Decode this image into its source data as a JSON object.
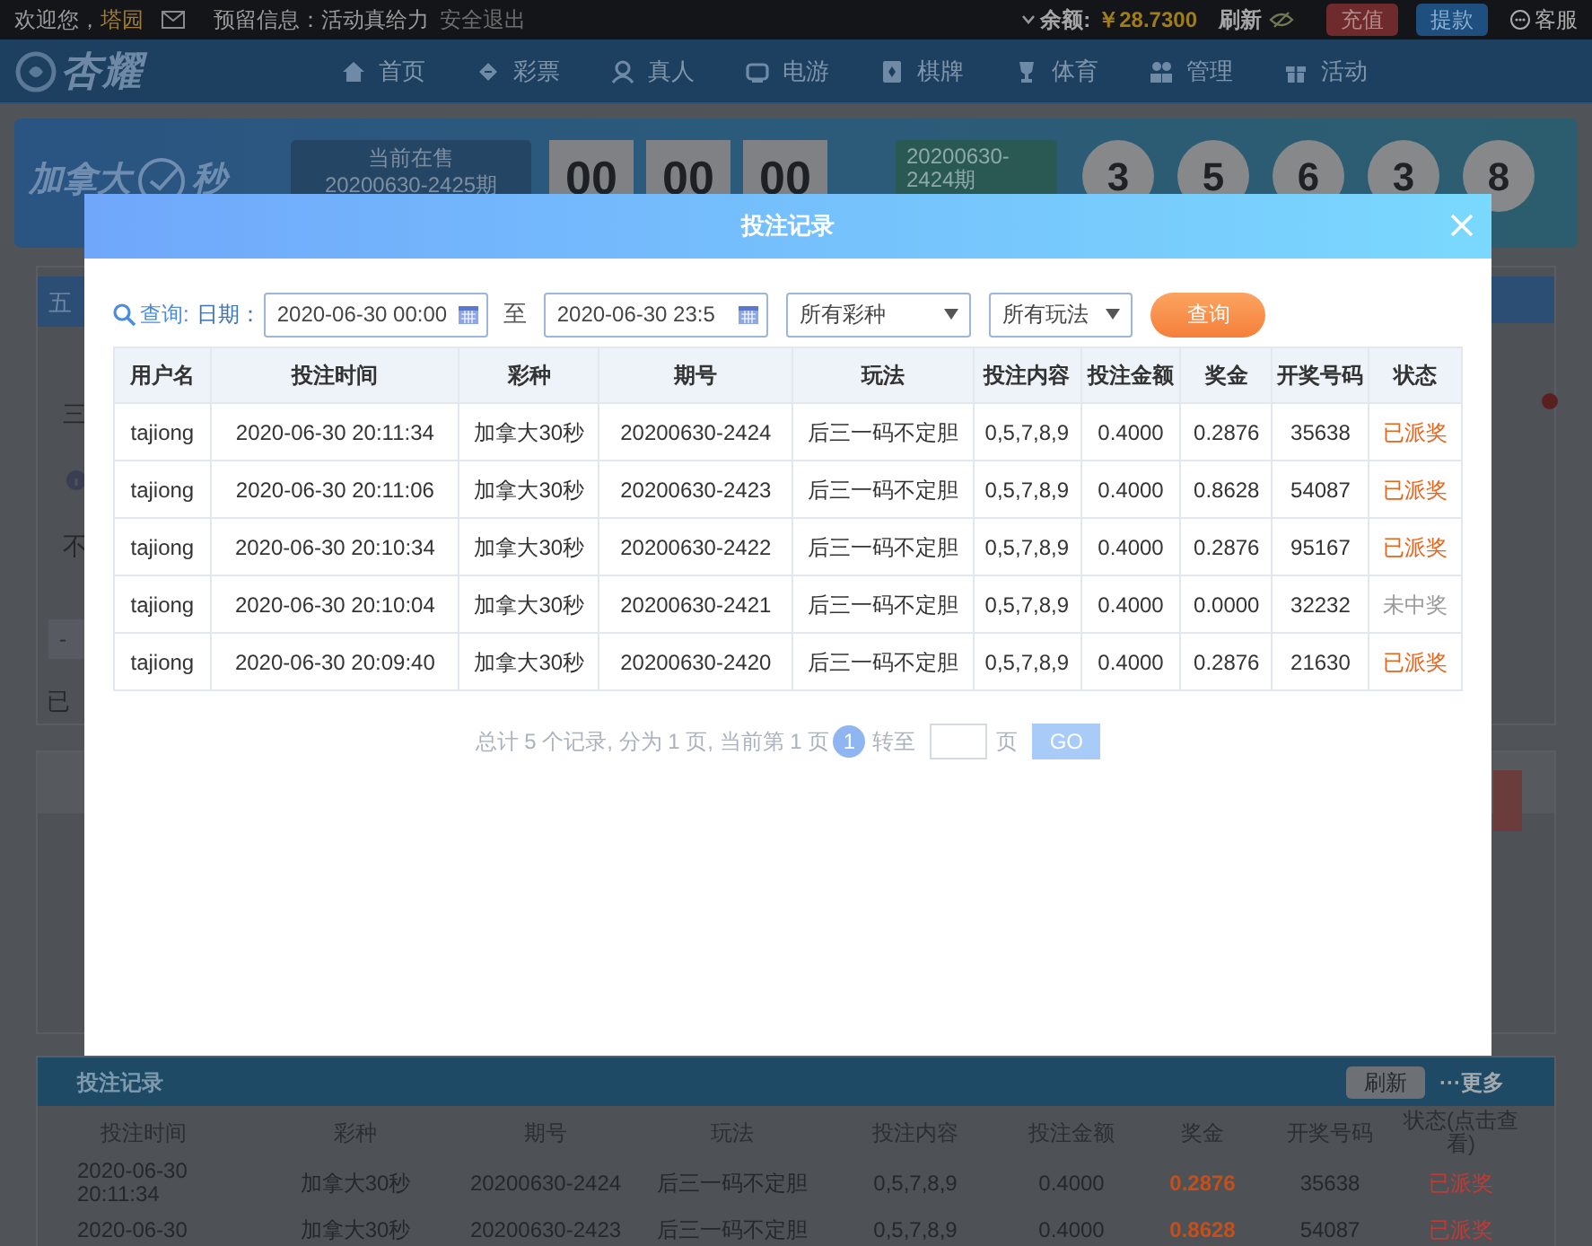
{
  "top_bar": {
    "greeting": "欢迎您，",
    "username": "塔园",
    "notice": "预留信息：活动真给力",
    "logout": "安全退出",
    "balance_label": "余额:",
    "balance": "￥28.7300",
    "refresh": "刷新",
    "deposit": "充值",
    "withdraw": "提款",
    "service": "客服"
  },
  "nav": {
    "logo": "杏耀",
    "items": [
      {
        "label": "首页",
        "kind": "home"
      },
      {
        "label": "彩票",
        "kind": "ticket"
      },
      {
        "label": "真人",
        "kind": "person"
      },
      {
        "label": "电游",
        "kind": "game"
      },
      {
        "label": "棋牌",
        "kind": "cards"
      },
      {
        "label": "体育",
        "kind": "trophy"
      },
      {
        "label": "管理",
        "kind": "people"
      },
      {
        "label": "活动",
        "kind": "gift"
      }
    ]
  },
  "lottery_header": {
    "name_left": "加拿大",
    "name_right": "秒",
    "current_label": "当前在售",
    "current_issue": "20200630-2425期",
    "countdown": [
      "00",
      "00",
      "00"
    ],
    "last_issue": [
      "20200630-",
      "2424期"
    ],
    "balls": [
      "3",
      "5",
      "6",
      "3",
      "8"
    ]
  },
  "panel_fragments": {
    "tab": "五",
    "row_1": "三",
    "row_2": "不",
    "stepper": "-",
    "selected": "已"
  },
  "modal": {
    "title": "投注记录",
    "search_label": "查询:",
    "date_label": "日期：",
    "date_from": "2020-06-30 00:00",
    "to_label": "至",
    "date_to": "2020-06-30 23:5",
    "lottery_select": "所有彩种",
    "play_select": "所有玩法",
    "query_button": "查询",
    "columns": [
      "用户名",
      "投注时间",
      "彩种",
      "期号",
      "玩法",
      "投注内容",
      "投注金额",
      "奖金",
      "开奖号码",
      "状态"
    ],
    "rows": [
      {
        "cells": [
          "tajiong",
          "2020-06-30 20:11:34",
          "加拿大30秒",
          "20200630-2424",
          "后三一码不定胆",
          "0,5,7,8,9",
          "0.4000",
          "0.2876",
          "35638",
          "已派奖"
        ],
        "won": true
      },
      {
        "cells": [
          "tajiong",
          "2020-06-30 20:11:06",
          "加拿大30秒",
          "20200630-2423",
          "后三一码不定胆",
          "0,5,7,8,9",
          "0.4000",
          "0.8628",
          "54087",
          "已派奖"
        ],
        "won": true
      },
      {
        "cells": [
          "tajiong",
          "2020-06-30 20:10:34",
          "加拿大30秒",
          "20200630-2422",
          "后三一码不定胆",
          "0,5,7,8,9",
          "0.4000",
          "0.2876",
          "95167",
          "已派奖"
        ],
        "won": true
      },
      {
        "cells": [
          "tajiong",
          "2020-06-30 20:10:04",
          "加拿大30秒",
          "20200630-2421",
          "后三一码不定胆",
          "0,5,7,8,9",
          "0.4000",
          "0.0000",
          "32232",
          "未中奖"
        ],
        "won": false
      },
      {
        "cells": [
          "tajiong",
          "2020-06-30 20:09:40",
          "加拿大30秒",
          "20200630-2420",
          "后三一码不定胆",
          "0,5,7,8,9",
          "0.4000",
          "0.2876",
          "21630",
          "已派奖"
        ],
        "won": true
      }
    ],
    "pagination": {
      "summary": "总计 5 个记录, 分为 1 页, 当前第 1 页",
      "pages": [
        {
          "label": "1",
          "selected": true
        }
      ],
      "goto_label": "转至",
      "page_unit": "页",
      "go_button": "GO"
    }
  },
  "bottom_panel": {
    "title": "投注记录",
    "refresh": "刷新",
    "more": "···更多",
    "columns": [
      "投注时间",
      "彩种",
      "期号",
      "玩法",
      "投注内容",
      "投注金额",
      "奖金",
      "开奖号码",
      "状态(点击查看)"
    ],
    "rows": [
      {
        "cells": [
          [
            "2020-06-30",
            "20:11:34"
          ],
          "加拿大30秒",
          "20200630-2424",
          "后三一码不定胆",
          "0,5,7,8,9",
          "0.4000",
          "0.2876",
          "35638",
          "已派奖"
        ]
      },
      {
        "cells": [
          [
            "2020-06-30"
          ],
          "加拿大30秒",
          "20200630-2423",
          "后三一码不定胆",
          "0,5,7,8,9",
          "0.4000",
          "0.8628",
          "54087",
          "已派奖"
        ]
      }
    ]
  }
}
